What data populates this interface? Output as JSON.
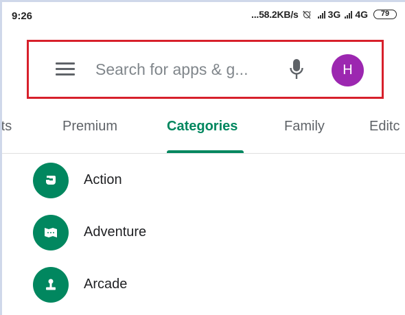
{
  "status_bar": {
    "time": "9:26",
    "network_speed": "...58.2KB/s",
    "net1": "3G",
    "net2": "4G",
    "net2_suffix": "ᵤ",
    "battery": "79"
  },
  "search": {
    "placeholder": "Search for apps & g...",
    "avatar_initial": "H"
  },
  "tabs": [
    {
      "label": "rts"
    },
    {
      "label": "Premium"
    },
    {
      "label": "Categories"
    },
    {
      "label": "Family"
    },
    {
      "label": "Editc"
    }
  ],
  "categories": [
    {
      "label": "Action",
      "icon": "action-icon"
    },
    {
      "label": "Adventure",
      "icon": "adventure-icon"
    },
    {
      "label": "Arcade",
      "icon": "arcade-icon"
    }
  ],
  "colors": {
    "accent": "#01875f",
    "avatar": "#9c27b0",
    "highlight": "#d7202b"
  }
}
